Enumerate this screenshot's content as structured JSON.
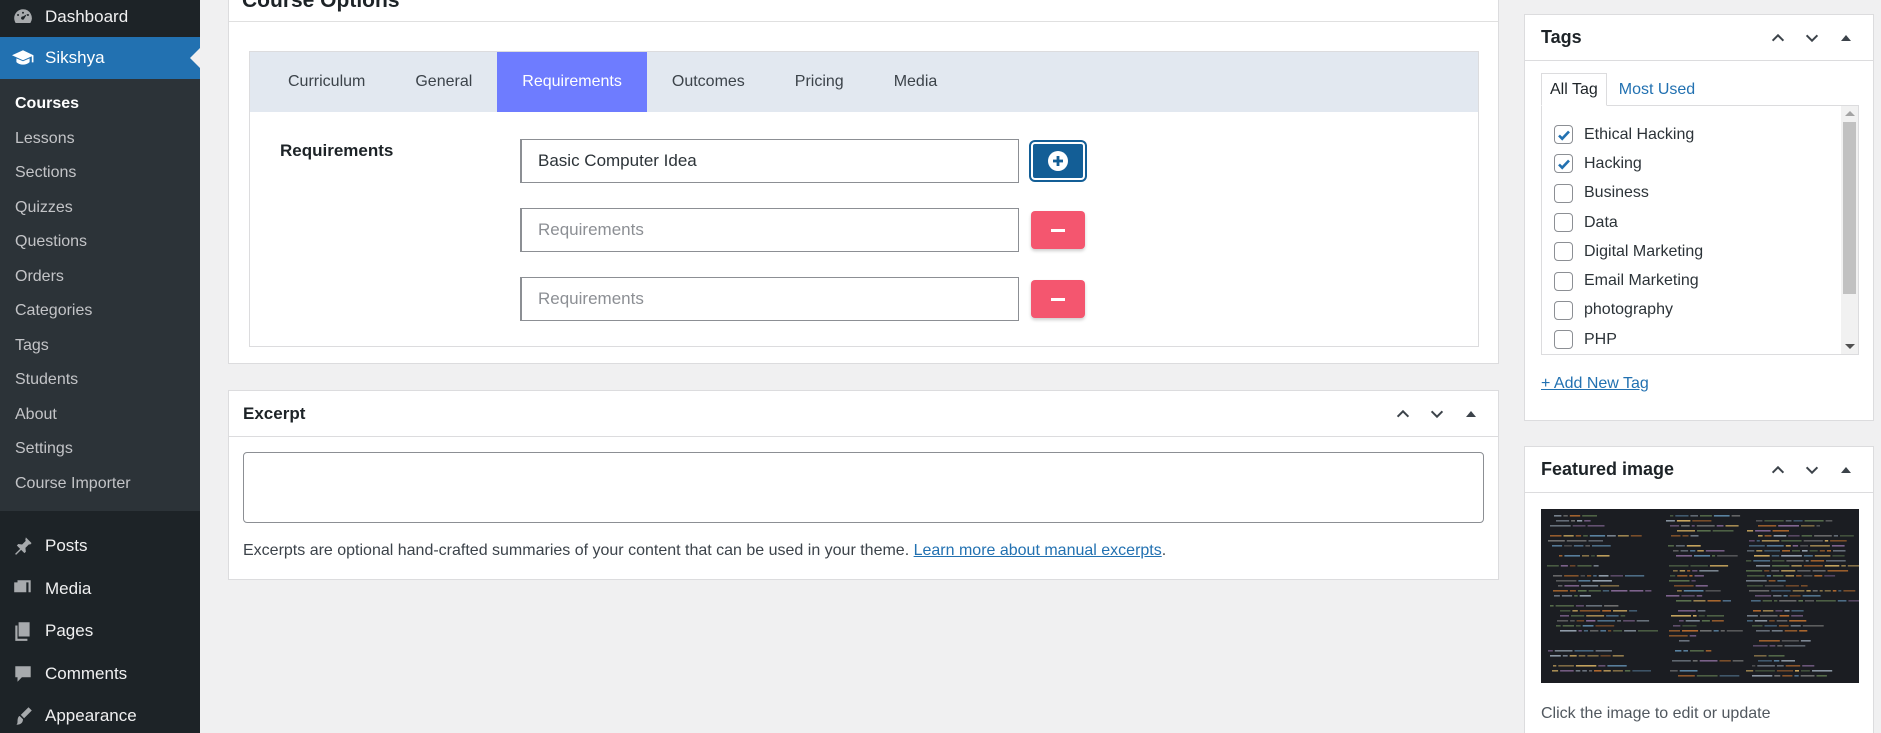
{
  "sidebar": {
    "dashboard": "Dashboard",
    "sikshya": "Sikshya",
    "submenu": [
      "Courses",
      "Lessons",
      "Sections",
      "Quizzes",
      "Questions",
      "Orders",
      "Categories",
      "Tags",
      "Students",
      "About",
      "Settings",
      "Course Importer"
    ],
    "posts": "Posts",
    "media": "Media",
    "pages": "Pages",
    "comments": "Comments",
    "appearance": "Appearance"
  },
  "course_options": {
    "title": "Course Options",
    "tabs": [
      "Curriculum",
      "General",
      "Requirements",
      "Outcomes",
      "Pricing",
      "Media"
    ],
    "active_tab": "Requirements",
    "requirements_label": "Requirements",
    "requirement_values": [
      "Basic Computer Idea",
      "",
      ""
    ],
    "requirement_placeholder": "Requirements"
  },
  "excerpt": {
    "title": "Excerpt",
    "help_text": "Excerpts are optional hand-crafted summaries of your content that can be used in your theme.",
    "help_link": "Learn more about manual excerpts",
    "help_suffix": "."
  },
  "tags": {
    "title": "Tags",
    "tab_all": "All Tag",
    "tab_most_used": "Most Used",
    "items": [
      {
        "label": "Ethical Hacking",
        "checked": true
      },
      {
        "label": "Hacking",
        "checked": true
      },
      {
        "label": "Business",
        "checked": false
      },
      {
        "label": "Data",
        "checked": false
      },
      {
        "label": "Digital Marketing",
        "checked": false
      },
      {
        "label": "Email Marketing",
        "checked": false
      },
      {
        "label": "photography",
        "checked": false
      },
      {
        "label": "PHP",
        "checked": false
      }
    ],
    "add_new": "+ Add New Tag"
  },
  "featured_image": {
    "title": "Featured image",
    "caption": "Click the image to edit or update"
  },
  "colors": {
    "admin_bar": "#1d2327",
    "accent": "#2271b1",
    "active_tab": "#6e7cff",
    "remove_button": "#f4566f"
  }
}
